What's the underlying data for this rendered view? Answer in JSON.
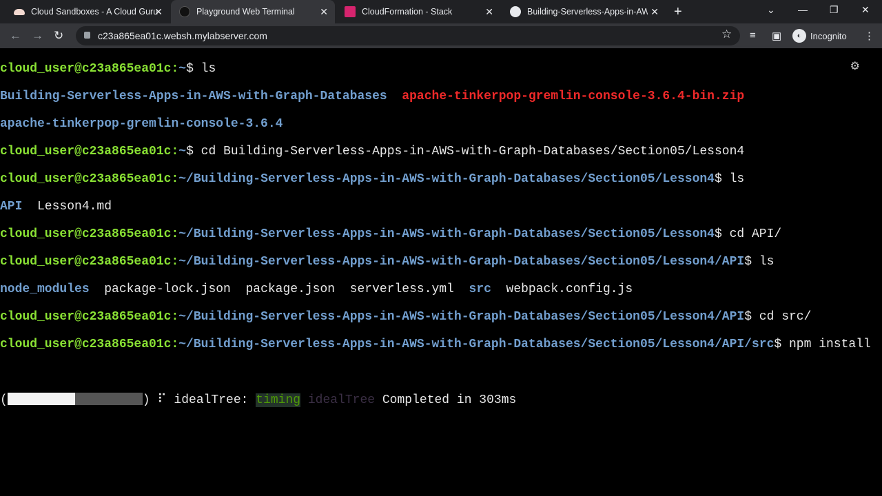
{
  "tabs": [
    {
      "title": "Cloud Sandboxes - A Cloud Guru",
      "icon": "cloud-icon",
      "active": false
    },
    {
      "title": "Playground Web Terminal",
      "icon": "terminal-icon",
      "active": true
    },
    {
      "title": "CloudFormation - Stack",
      "icon": "cloudformation-icon",
      "active": false
    },
    {
      "title": "Building-Serverless-Apps-in-AWS",
      "icon": "github-icon",
      "active": false
    }
  ],
  "address": {
    "url": "c23a865ea01c.websh.mylabserver.com"
  },
  "profile": {
    "label": "Incognito"
  },
  "terminal": {
    "prompt_home": "cloud_user@c23a865ea01c:",
    "lines": {
      "l1_path": "~",
      "l1_cmd": "$ ls",
      "l2_dir": "Building-Serverless-Apps-in-AWS-with-Graph-Databases",
      "l2_zip": "apache-tinkerpop-gremlin-console-3.6.4-bin.zip",
      "l3_dir": "apache-tinkerpop-gremlin-console-3.6.4",
      "l4_path": "~",
      "l4_cmd": "$ cd Building-Serverless-Apps-in-AWS-with-Graph-Databases/Section05/Lesson4",
      "l5_path": "~/Building-Serverless-Apps-in-AWS-with-Graph-Databases/Section05/Lesson4",
      "l5_cmd": "$ ls",
      "l6_dir": "API",
      "l6_file": "  Lesson4.md",
      "l7_path": "~/Building-Serverless-Apps-in-AWS-with-Graph-Databases/Section05/Lesson4",
      "l7_cmd": "$ cd API/",
      "l8_path": "~/Building-Serverless-Apps-in-AWS-with-Graph-Databases/Section05/Lesson4/API",
      "l8_cmd": "$ ls",
      "l9_a": "node_modules",
      "l9_b": "  package-lock.json  package.json  serverless.yml  ",
      "l9_c": "src",
      "l9_d": "  webpack.config.js",
      "l10_path": "~/Building-Serverless-Apps-in-AWS-with-Graph-Databases/Section05/Lesson4/API",
      "l10_cmd": "$ cd src/",
      "l11_path": "~/Building-Serverless-Apps-in-AWS-with-Graph-Databases/Section05/Lesson4/API/src",
      "l11_cmd": "$ npm install"
    },
    "progress": {
      "fraction": 0.5,
      "spinner": "⠏",
      "stage": " idealTree: ",
      "tag": "timing",
      "dim": " idealTree",
      "msg": " Completed in 303ms"
    }
  }
}
